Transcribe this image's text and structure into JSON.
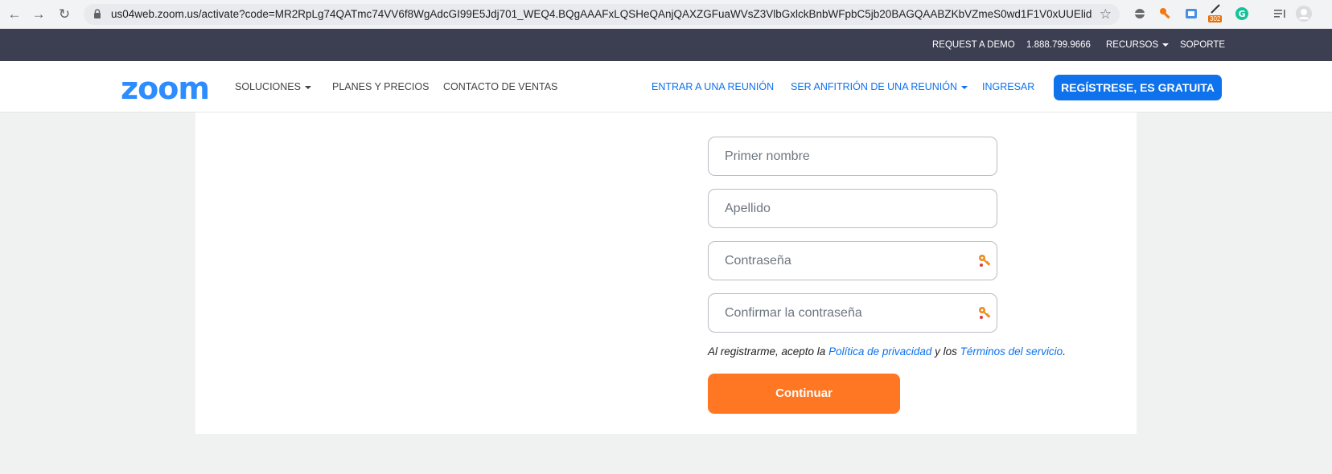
{
  "browser": {
    "url": "us04web.zoom.us/activate?code=MR2RpLg74QATmc74VV6f8WgAdcGI99E5Jdj701_WEQ4.BQgAAAFxLQSHeQAnjQAXZGFuaWVsZ3VlbGxlckBnbWFpbC5jb20BAGQAABZKbVZmeS0wd1F1V0xUUElid...",
    "extension_badge": "302"
  },
  "topbar": {
    "request_demo": "REQUEST A DEMO",
    "phone": "1.888.799.9666",
    "resources": "RECURSOS",
    "support": "SOPORTE"
  },
  "nav": {
    "logo": "zoom",
    "solutions": "SOLUCIONES",
    "plans": "PLANES Y PRECIOS",
    "sales": "CONTACTO DE VENTAS",
    "join": "ENTRAR A UNA REUNIÓN",
    "host": "SER ANFITRIÓN DE UNA REUNIÓN",
    "signin": "INGRESAR",
    "signup": "REGÍSTRESE, ES GRATUITA"
  },
  "form": {
    "first_name_placeholder": "Primer nombre",
    "last_name_placeholder": "Apellido",
    "password_placeholder": "Contraseña",
    "confirm_password_placeholder": "Confirmar la contraseña",
    "terms_prefix": "Al registrarme, acepto la ",
    "privacy_link": "Política de privacidad",
    "terms_middle": " y los ",
    "terms_link": "Términos del servicio",
    "terms_suffix": ".",
    "continue_label": "Continuar"
  },
  "colors": {
    "brand_blue": "#0e72ed",
    "logo_blue": "#2d8cff",
    "continue_orange": "#ff7623",
    "topbar_dark": "#3c3e52"
  }
}
